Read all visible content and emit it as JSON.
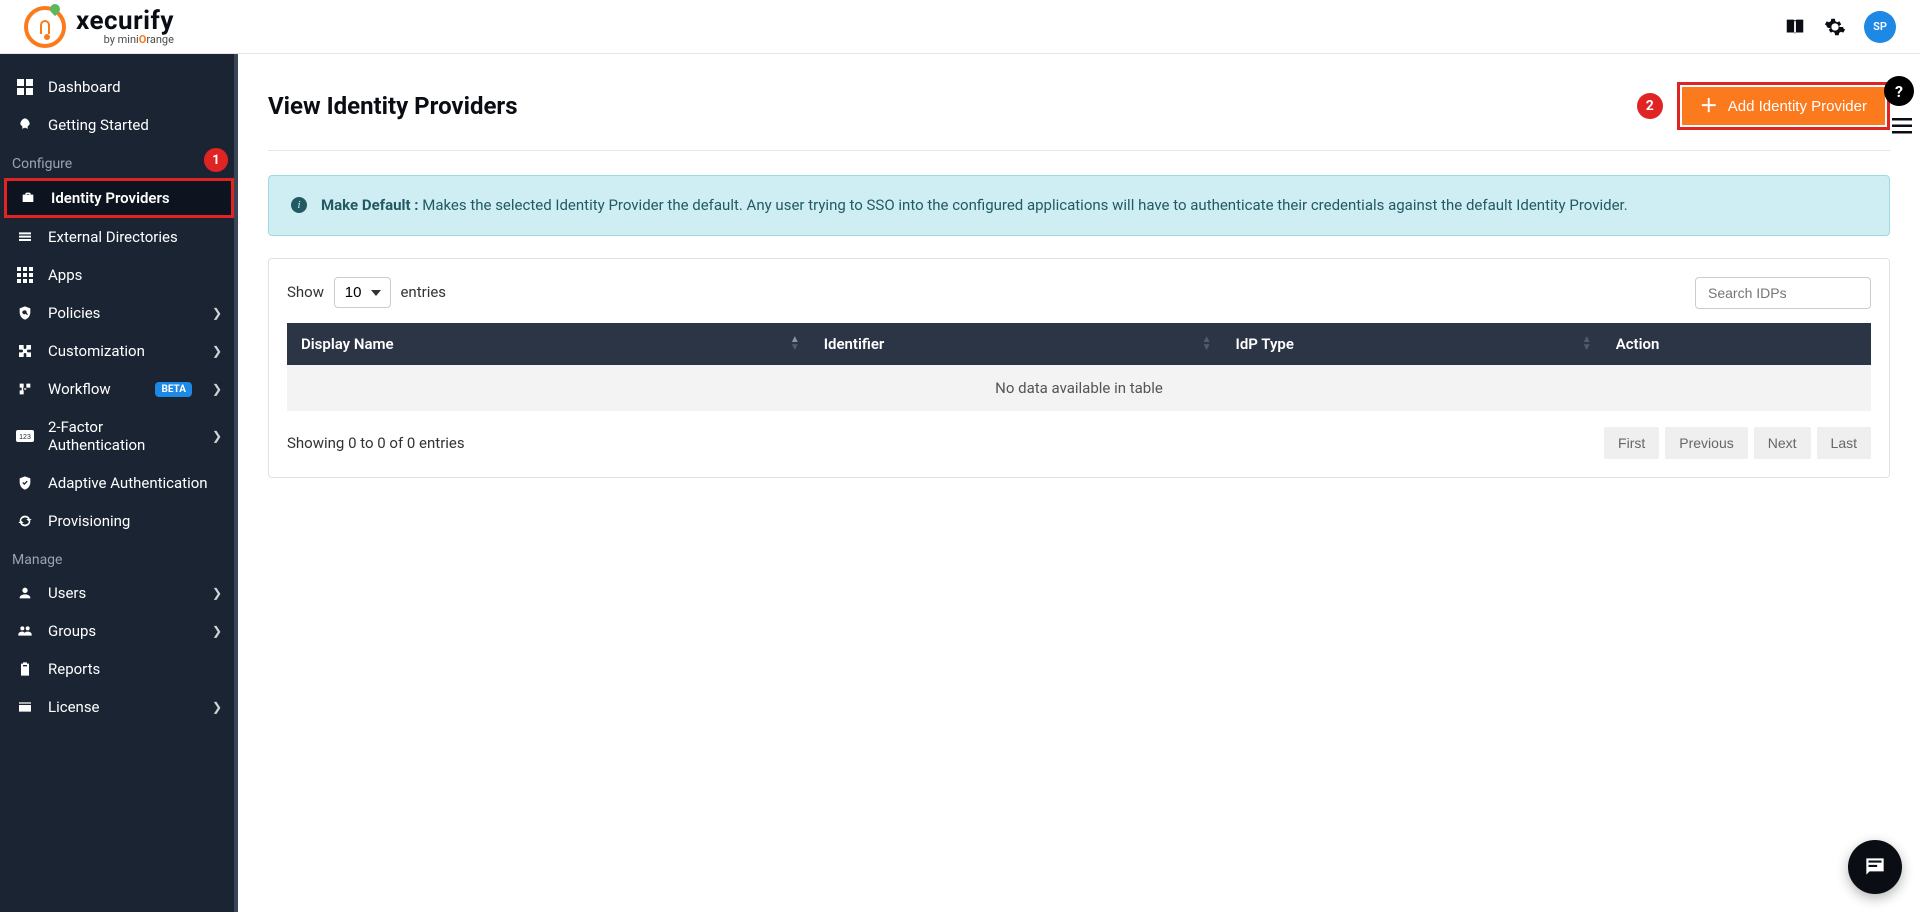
{
  "brand": {
    "name": "xecurify",
    "byline_prefix": "by mini",
    "byline_highlight": "O",
    "byline_suffix": "range"
  },
  "topbar": {
    "avatar_initials": "SP"
  },
  "sidebar": {
    "items": [
      {
        "label": "Dashboard"
      },
      {
        "label": "Getting Started"
      }
    ],
    "section_configure": "Configure",
    "configure_items": [
      {
        "label": "Identity Providers",
        "active": true
      },
      {
        "label": "External Directories"
      },
      {
        "label": "Apps"
      },
      {
        "label": "Policies",
        "expandable": true
      },
      {
        "label": "Customization",
        "expandable": true
      },
      {
        "label": "Workflow",
        "beta": "BETA",
        "expandable": true
      },
      {
        "label": "2-Factor Authentication",
        "expandable": true
      },
      {
        "label": "Adaptive Authentication"
      },
      {
        "label": "Provisioning"
      }
    ],
    "section_manage": "Manage",
    "manage_items": [
      {
        "label": "Users",
        "expandable": true
      },
      {
        "label": "Groups",
        "expandable": true
      },
      {
        "label": "Reports"
      },
      {
        "label": "License",
        "expandable": true
      }
    ],
    "callout_1": "1"
  },
  "page": {
    "title": "View Identity Providers",
    "add_button": "Add Identity Provider",
    "callout_2": "2"
  },
  "banner": {
    "bold": "Make Default :",
    "text": " Makes the selected Identity Provider the default. Any user trying to SSO into the configured applications will have to authenticate their credentials against the default Identity Provider."
  },
  "table": {
    "show_label": "Show",
    "entries_label": "entries",
    "entries_options": [
      "10"
    ],
    "entries_value": "10",
    "search_placeholder": "Search IDPs",
    "columns": [
      "Display Name",
      "Identifier",
      "IdP Type",
      "Action"
    ],
    "empty": "No data available in table",
    "footer_info": "Showing 0 to 0 of 0 entries",
    "pager": {
      "first": "First",
      "prev": "Previous",
      "next": "Next",
      "last": "Last"
    }
  }
}
